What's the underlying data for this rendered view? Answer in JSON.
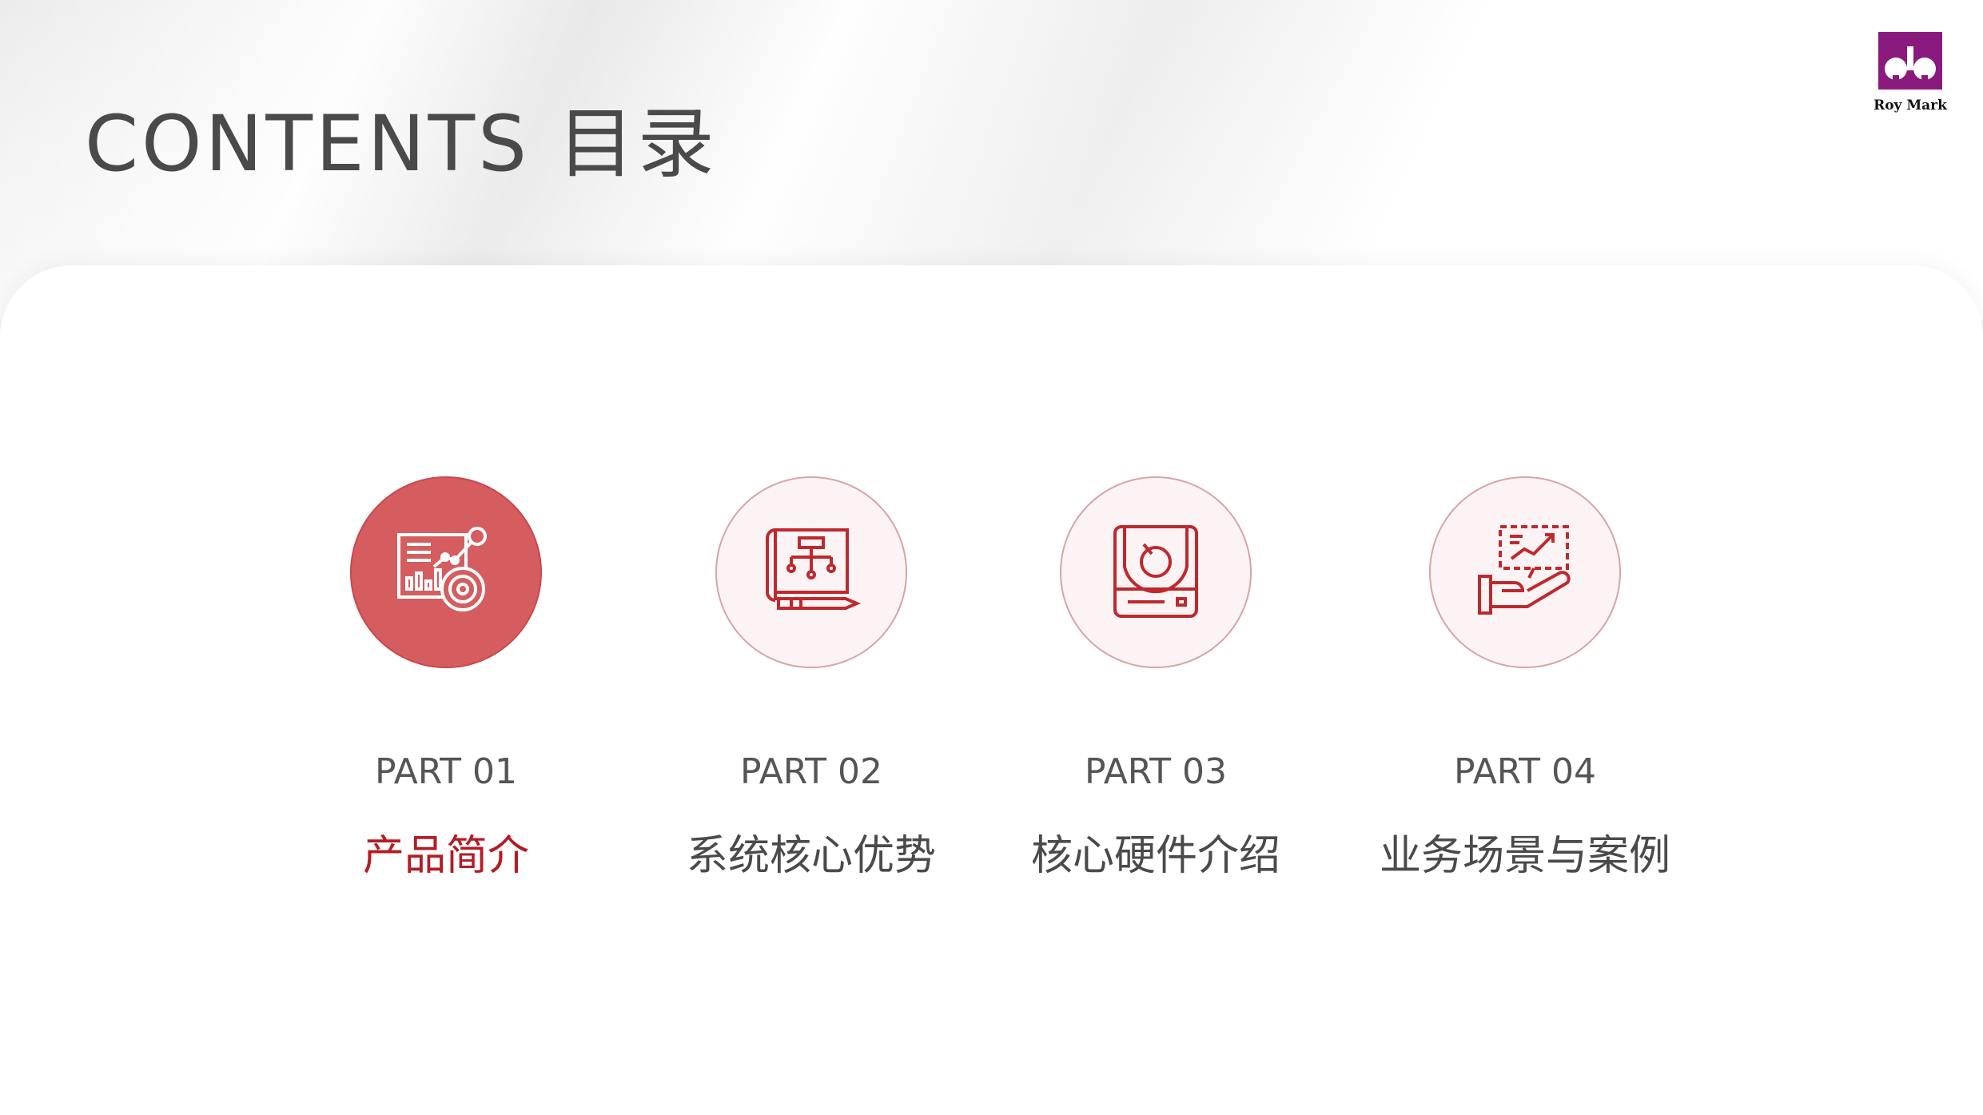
{
  "title": "CONTENTS 目录",
  "logo": {
    "text": "Roy Mark",
    "color": "#8b1a7e"
  },
  "colors": {
    "accent": "#b51c24",
    "active_circle": "#d55d60",
    "inactive_circle": "#fcf4f4"
  },
  "items": [
    {
      "part": "PART 01",
      "label": "产品简介",
      "icon": "analytics-dashboard-icon",
      "active": true
    },
    {
      "part": "PART 02",
      "label": "系统核心优势",
      "icon": "blueprint-flowchart-icon",
      "active": false
    },
    {
      "part": "PART 03",
      "label": "核心硬件介绍",
      "icon": "hardware-device-icon",
      "active": false
    },
    {
      "part": "PART 04",
      "label": "业务场景与案例",
      "icon": "hand-presentation-icon",
      "active": false
    }
  ]
}
